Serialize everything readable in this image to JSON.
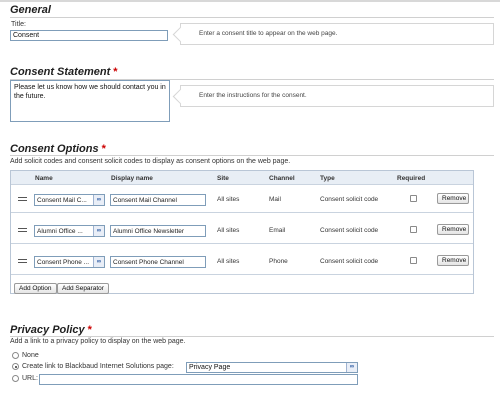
{
  "general": {
    "heading": "General",
    "title_label": "Title:",
    "title_value": "Consent",
    "title_hint": "Enter a consent title to appear on the web page."
  },
  "statement": {
    "heading": "Consent Statement",
    "required_mark": "*",
    "text": "Please let us know how we should contact you in the future.",
    "hint": "Enter the instructions for the consent."
  },
  "options": {
    "heading": "Consent Options",
    "required_mark": "*",
    "description": "Add solicit codes and consent solicit codes to display as consent options on the web page.",
    "columns": [
      "Name",
      "Display name",
      "Site",
      "Channel",
      "Type",
      "Required"
    ],
    "rows": [
      {
        "name": "Consent Mail C...",
        "display_name": "Consent Mail Channel",
        "site": "All sites",
        "channel": "Mail",
        "type": "Consent solicit code",
        "remove": "Remove"
      },
      {
        "name": "Alumni Office ...",
        "display_name": "Alumni Office Newsletter",
        "site": "All sites",
        "channel": "Email",
        "type": "Consent solicit code",
        "remove": "Remove"
      },
      {
        "name": "Consent Phone ...",
        "display_name": "Consent Phone Channel",
        "site": "All sites",
        "channel": "Phone",
        "type": "Consent solicit code",
        "remove": "Remove"
      }
    ],
    "add_option": "Add Option",
    "add_separator": "Add Separator"
  },
  "privacy": {
    "heading": "Privacy Policy",
    "required_mark": "*",
    "description": "Add a link to a privacy policy to display on the web page.",
    "radio_none": "None",
    "radio_create_link": "Create link to Blackbaud Internet Solutions page:",
    "page_value": "Privacy Page",
    "radio_url": "URL:",
    "selected": "create_link"
  },
  "colors": {
    "required": "#cc0000",
    "grid_header": "#e8eef5",
    "input_border": "#7f9db9"
  },
  "icons": {
    "lookup": "binoculars-icon",
    "drag": "drag-handle-icon"
  }
}
